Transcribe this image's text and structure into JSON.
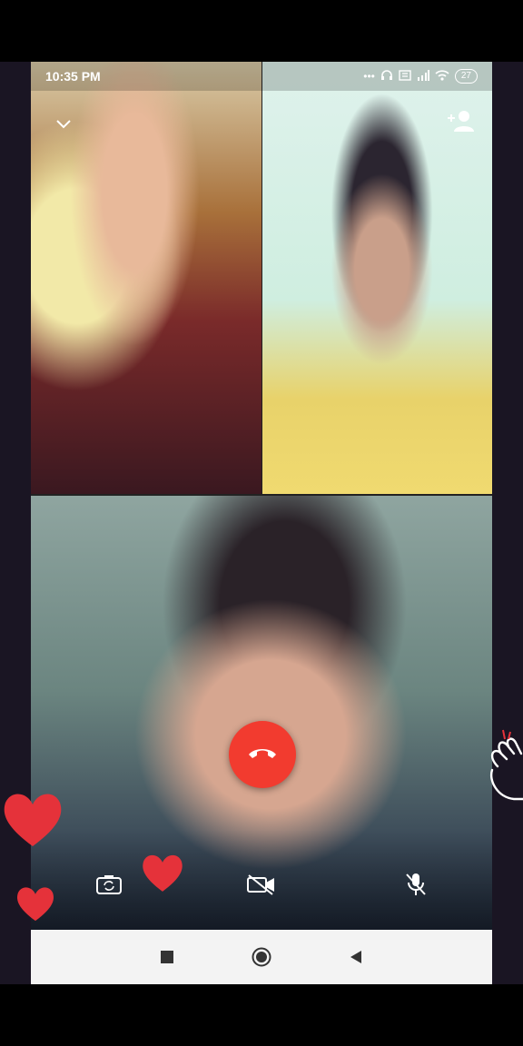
{
  "status_bar": {
    "time": "10:35 PM",
    "battery": "27",
    "icons": [
      "more-dots-icon",
      "headset-icon",
      "data-icon",
      "signal-icon",
      "wifi-icon",
      "battery-icon"
    ]
  },
  "call": {
    "participants": [
      "participant-top-left",
      "participant-top-right",
      "participant-self"
    ],
    "controls": {
      "switch_camera": "camera-switch-icon",
      "video_toggle": "video-off-icon",
      "mute_toggle": "mic-off-icon",
      "end_call": "end-call-icon"
    },
    "add_participant": "add-person-icon",
    "end_color": "#f23b2f"
  },
  "navigation": [
    "recent-apps-icon",
    "home-icon",
    "back-icon"
  ],
  "decorations": {
    "heart_color": "#e5323a",
    "sticker": "wave-hand-icon"
  }
}
